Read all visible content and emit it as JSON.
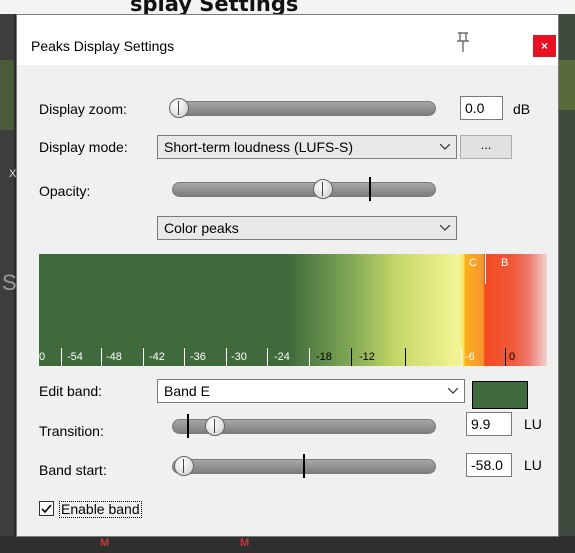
{
  "background": {
    "title_fragment": "splay Settings",
    "side_text": "St",
    "side_x": "X",
    "mute_label": "M"
  },
  "dialog": {
    "title": "Peaks Display Settings",
    "close_glyph": "×"
  },
  "display_zoom": {
    "label": "Display zoom:",
    "value": "0.0",
    "unit": "dB",
    "slider_fraction": 0.0
  },
  "display_mode": {
    "label": "Display mode:",
    "selected": "Short-term loudness (LUFS-S)",
    "more_label": "..."
  },
  "opacity": {
    "label": "Opacity:",
    "selected": "Color peaks",
    "slider_fraction": 0.55
  },
  "peaks_scale": {
    "labels": [
      "0",
      "-54",
      "-48",
      "-42",
      "-36",
      "-30",
      "-24",
      "-18",
      "-12",
      "-6",
      "0"
    ],
    "markers": [
      "C",
      "B"
    ],
    "band_color": "#3f6b3c",
    "warn_color": "#fcb01a",
    "clip_color": "#f44a23"
  },
  "edit_band": {
    "label": "Edit band:",
    "selected": "Band E",
    "swatch_color": "#3f6b3c"
  },
  "transition": {
    "label": "Transition:",
    "value": "9.9",
    "unit": "LU"
  },
  "band_start": {
    "label": "Band start:",
    "value": "-58.0",
    "unit": "LU"
  },
  "enable_band": {
    "label": "Enable band",
    "checked": true
  }
}
